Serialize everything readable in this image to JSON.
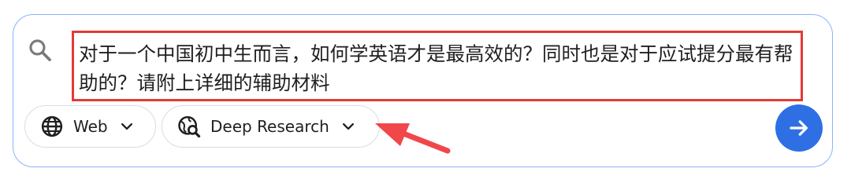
{
  "search": {
    "query": "对于一个中国初中生而言，如何学英语才是最高效的？同时也是对于应试提分最有帮助的？请附上详细的辅助材料"
  },
  "toolbar": {
    "web_label": "Web",
    "deep_research_label": "Deep Research"
  },
  "icons": {
    "search": "search-icon",
    "web": "globe-icon",
    "deep_research": "deep-research-icon",
    "chevron": "chevron-down-icon",
    "submit": "arrow-right-icon"
  },
  "colors": {
    "card_border": "#8ab4f8",
    "highlight": "#e53935",
    "submit": "#2f6fe4",
    "annotation_arrow": "#f0474a"
  }
}
